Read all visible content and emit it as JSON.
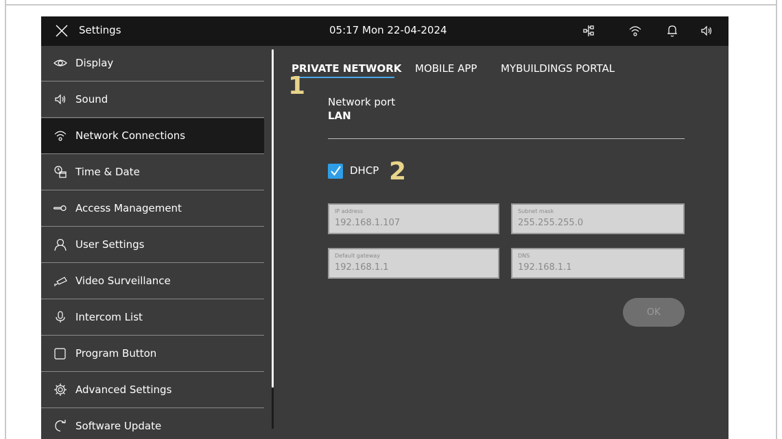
{
  "header": {
    "title": "Settings",
    "datetime": "05:17  Mon 22-04-2024"
  },
  "sidebar": {
    "items": [
      {
        "label": "Display",
        "icon": "eye-icon"
      },
      {
        "label": "Sound",
        "icon": "speaker-icon"
      },
      {
        "label": "Network Connections",
        "icon": "wifi-icon",
        "active": true
      },
      {
        "label": "Time & Date",
        "icon": "clock-calendar-icon"
      },
      {
        "label": "Access Management",
        "icon": "key-icon"
      },
      {
        "label": "User Settings",
        "icon": "user-icon"
      },
      {
        "label": "Video Surveillance",
        "icon": "camera-icon"
      },
      {
        "label": "Intercom List",
        "icon": "microphone-icon"
      },
      {
        "label": "Program Button",
        "icon": "square-button-icon"
      },
      {
        "label": "Advanced Settings",
        "icon": "gear-icon"
      },
      {
        "label": "Software Update",
        "icon": "refresh-icon"
      }
    ]
  },
  "tabs": [
    {
      "label": "PRIVATE NETWORK",
      "active": true
    },
    {
      "label": "MOBILE APP"
    },
    {
      "label": "MYBUILDINGS PORTAL"
    }
  ],
  "markers": {
    "one": "1",
    "two": "2"
  },
  "network": {
    "port_label": "Network port",
    "port_value": "LAN",
    "dhcp_label": "DHCP",
    "dhcp_checked": true,
    "fields": [
      {
        "label": "IP address",
        "value": "192.168.1.107"
      },
      {
        "label": "Subnet mask",
        "value": "255.255.255.0"
      },
      {
        "label": "Default gateway",
        "value": "192.168.1.1"
      },
      {
        "label": "DNS",
        "value": "192.168.1.1"
      }
    ],
    "ok_label": "OK"
  },
  "colors": {
    "accent": "#2f9ee6",
    "topbar": "#161616",
    "panel": "#3b3b3b",
    "marker": "#e8d48a"
  }
}
